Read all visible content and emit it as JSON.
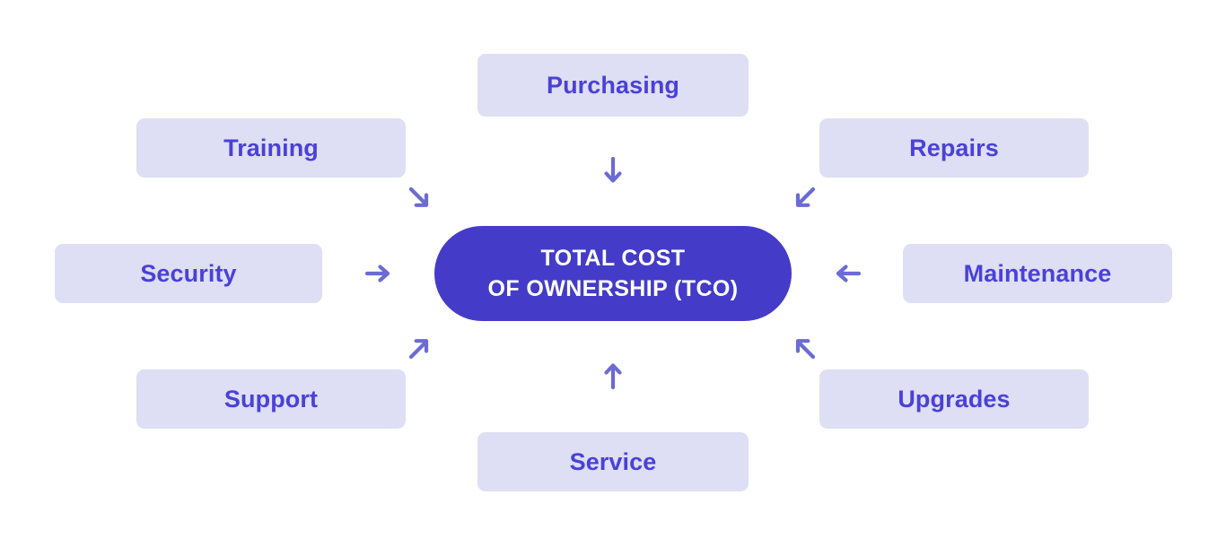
{
  "diagram": {
    "title": "Total Cost of Ownership (TCO) factors diagram",
    "background_color": "#ffffff",
    "accent_color": "#443cc8",
    "box_background_color": "#dedef4",
    "box_text_color": "#4a41d8",
    "arrow_color": "#6b6bd6"
  },
  "center": {
    "name": "total-cost-of-ownership",
    "line1": "TOTAL COST",
    "line2": "OF OWNERSHIP (TCO)"
  },
  "factors": [
    {
      "id": "purchasing",
      "label": "Purchasing",
      "position": "top-center",
      "arrow": "down",
      "arrow_icon": "arrow-down-icon"
    },
    {
      "id": "training",
      "label": "Training",
      "position": "top-left",
      "arrow": "down-right",
      "arrow_icon": "arrow-down-right-icon"
    },
    {
      "id": "repairs",
      "label": "Repairs",
      "position": "top-right",
      "arrow": "down-left",
      "arrow_icon": "arrow-down-left-icon"
    },
    {
      "id": "security",
      "label": "Security",
      "position": "middle-left",
      "arrow": "right",
      "arrow_icon": "arrow-right-icon"
    },
    {
      "id": "maintenance",
      "label": "Maintenance",
      "position": "middle-right",
      "arrow": "left",
      "arrow_icon": "arrow-left-icon"
    },
    {
      "id": "support",
      "label": "Support",
      "position": "bottom-left",
      "arrow": "up-right",
      "arrow_icon": "arrow-up-right-icon"
    },
    {
      "id": "upgrades",
      "label": "Upgrades",
      "position": "bottom-right",
      "arrow": "up-left",
      "arrow_icon": "arrow-up-left-icon"
    },
    {
      "id": "service",
      "label": "Service",
      "position": "bottom-center",
      "arrow": "up",
      "arrow_icon": "arrow-up-icon"
    }
  ]
}
